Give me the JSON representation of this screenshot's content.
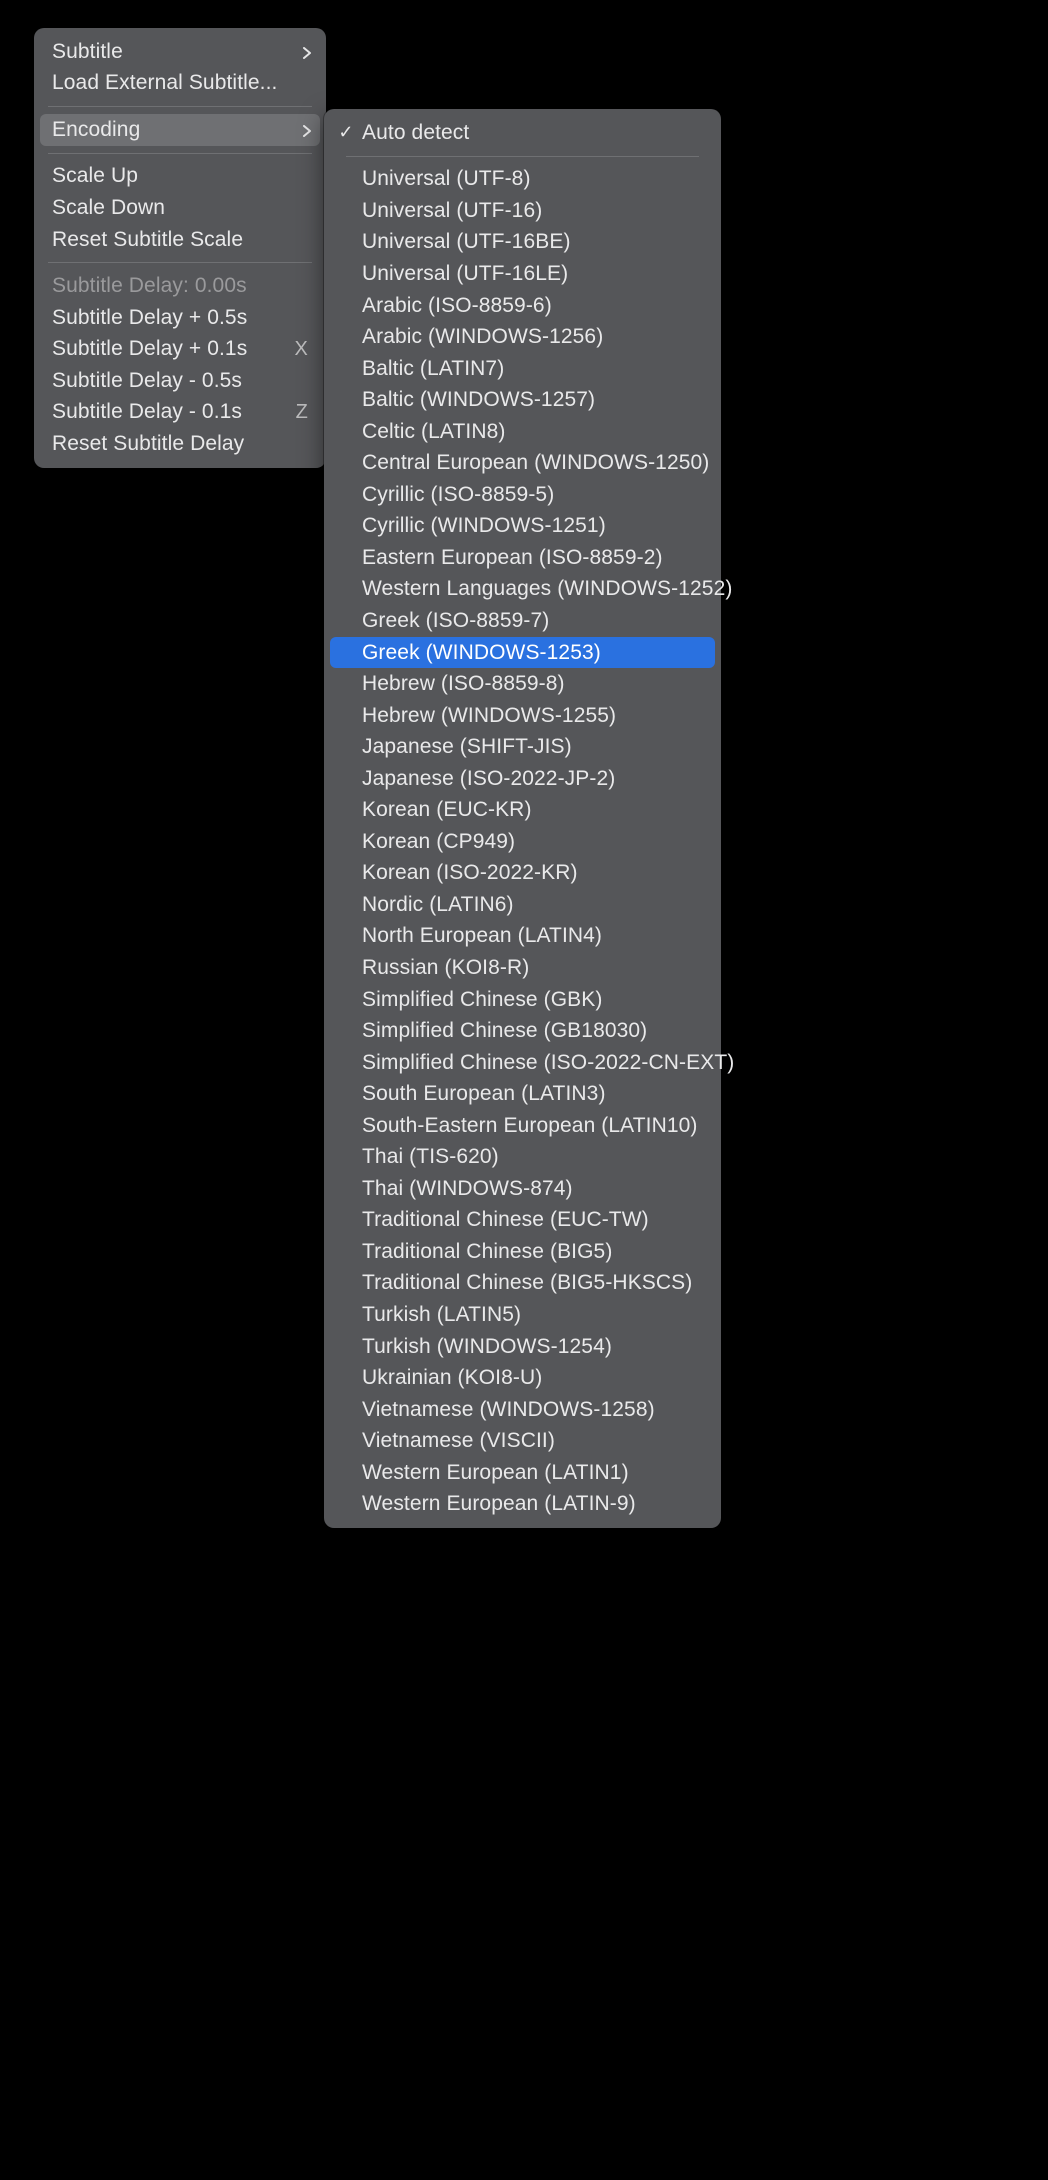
{
  "primary_menu": {
    "group1": [
      {
        "label": "Subtitle",
        "submenu": true
      },
      {
        "label": "Load External Subtitle..."
      }
    ],
    "group2": [
      {
        "label": "Encoding",
        "submenu": true,
        "hover": true
      }
    ],
    "group3": [
      {
        "label": "Scale Up"
      },
      {
        "label": "Scale Down"
      },
      {
        "label": "Reset Subtitle Scale"
      }
    ],
    "group4": [
      {
        "label": "Subtitle Delay: 0.00s",
        "disabled": true
      },
      {
        "label": "Subtitle Delay + 0.5s"
      },
      {
        "label": "Subtitle Delay + 0.1s",
        "shortcut": "X"
      },
      {
        "label": "Subtitle Delay - 0.5s"
      },
      {
        "label": "Subtitle Delay - 0.1s",
        "shortcut": "Z"
      },
      {
        "label": "Reset Subtitle Delay"
      }
    ]
  },
  "encoding_menu": {
    "top": [
      {
        "label": "Auto detect",
        "checked": true
      }
    ],
    "list": [
      "Universal (UTF-8)",
      "Universal (UTF-16)",
      "Universal (UTF-16BE)",
      "Universal (UTF-16LE)",
      "Arabic (ISO-8859-6)",
      "Arabic (WINDOWS-1256)",
      "Baltic (LATIN7)",
      "Baltic (WINDOWS-1257)",
      "Celtic (LATIN8)",
      "Central European (WINDOWS-1250)",
      "Cyrillic (ISO-8859-5)",
      "Cyrillic (WINDOWS-1251)",
      "Eastern European (ISO-8859-2)",
      "Western Languages (WINDOWS-1252)",
      "Greek (ISO-8859-7)",
      "Greek (WINDOWS-1253)",
      "Hebrew (ISO-8859-8)",
      "Hebrew (WINDOWS-1255)",
      "Japanese (SHIFT-JIS)",
      "Japanese (ISO-2022-JP-2)",
      "Korean (EUC-KR)",
      "Korean (CP949)",
      "Korean (ISO-2022-KR)",
      "Nordic (LATIN6)",
      "North European (LATIN4)",
      "Russian (KOI8-R)",
      "Simplified Chinese (GBK)",
      "Simplified Chinese (GB18030)",
      "Simplified Chinese (ISO-2022-CN-EXT)",
      "South European (LATIN3)",
      "South-Eastern European (LATIN10)",
      "Thai (TIS-620)",
      "Thai (WINDOWS-874)",
      "Traditional Chinese (EUC-TW)",
      "Traditional Chinese (BIG5)",
      "Traditional Chinese (BIG5-HKSCS)",
      "Turkish (LATIN5)",
      "Turkish (WINDOWS-1254)",
      "Ukrainian (KOI8-U)",
      "Vietnamese (WINDOWS-1258)",
      "Vietnamese (VISCII)",
      "Western European (LATIN1)",
      "Western European (LATIN-9)"
    ],
    "selected_index": 15
  }
}
